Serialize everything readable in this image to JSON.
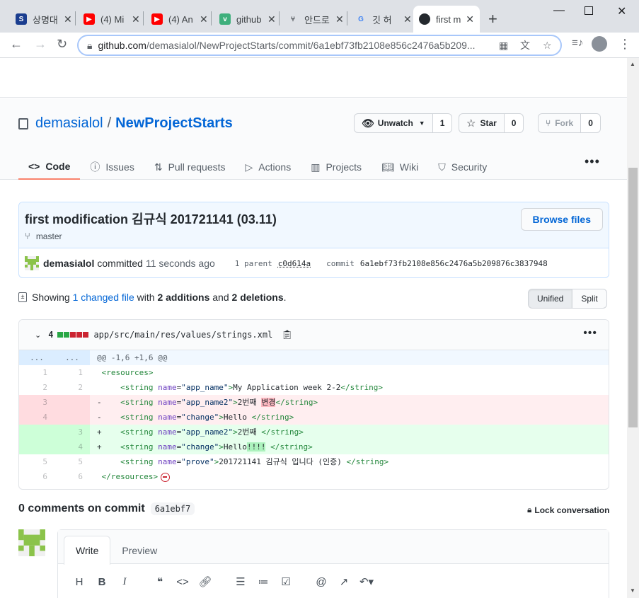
{
  "browser": {
    "tabs": [
      {
        "title": "상명대",
        "fav_color": "#1a3d8f",
        "fav_glyph": "S"
      },
      {
        "title": "(4) Mi",
        "fav_color": "#ff0000",
        "fav_glyph": "▶"
      },
      {
        "title": "(4) An",
        "fav_color": "#ff0000",
        "fav_glyph": "▶"
      },
      {
        "title": "github",
        "fav_color": "#3eaf7c",
        "fav_glyph": "v"
      },
      {
        "title": "안드로",
        "fav_color": "#ffffff",
        "fav_glyph": "⑂"
      },
      {
        "title": "깃 허",
        "fav_color": "#ffffff",
        "fav_glyph": "G"
      },
      {
        "title": "first m",
        "fav_color": "#ffffff",
        "fav_glyph": "●"
      }
    ],
    "url_host": "github.com",
    "url_path": "/demasialol/NewProjectStarts/commit/6a1ebf73fb2108e856c2476a5b209..."
  },
  "repo": {
    "owner": "demasialol",
    "name": "NewProjectStarts",
    "watch_label": "Unwatch",
    "watch_count": "1",
    "star_label": "Star",
    "star_count": "0",
    "fork_label": "Fork",
    "fork_count": "0",
    "nav": [
      {
        "label": "Code",
        "icon": "code-icon"
      },
      {
        "label": "Issues",
        "icon": "issue-icon"
      },
      {
        "label": "Pull requests",
        "icon": "pull-request-icon"
      },
      {
        "label": "Actions",
        "icon": "play-icon"
      },
      {
        "label": "Projects",
        "icon": "project-icon"
      },
      {
        "label": "Wiki",
        "icon": "book-icon"
      },
      {
        "label": "Security",
        "icon": "shield-icon"
      }
    ]
  },
  "commit": {
    "title": "first modification 김규식 201721141 (03.11)",
    "branch": "master",
    "browse_label": "Browse files",
    "author": "demasialol",
    "committed_text": "committed",
    "time": "11 seconds ago",
    "parent_label": "1 parent",
    "parent_sha": "c0d614a",
    "commit_label": "commit",
    "sha": "6a1ebf73fb2108e856c2476a5b209876c3837948"
  },
  "summary": {
    "showing": "Showing",
    "changed": "1 changed file",
    "with": "with",
    "additions": "2 additions",
    "and": "and",
    "deletions": "2 deletions",
    "end": ".",
    "unified": "Unified",
    "split": "Split"
  },
  "file": {
    "count": "4",
    "path": "app/src/main/res/values/strings.xml",
    "hunk": "@@ -1,6 +1,6 @@",
    "hunk_dots": "..."
  },
  "diff_lines": [
    {
      "type": "ctx",
      "old": "1",
      "new": "1",
      "marker": " "
    },
    {
      "type": "ctx",
      "old": "2",
      "new": "2",
      "marker": " "
    },
    {
      "type": "del",
      "old": "3",
      "new": "",
      "marker": "-"
    },
    {
      "type": "del",
      "old": "4",
      "new": "",
      "marker": "-"
    },
    {
      "type": "add",
      "old": "",
      "new": "3",
      "marker": "+"
    },
    {
      "type": "add",
      "old": "",
      "new": "4",
      "marker": "+"
    },
    {
      "type": "ctx",
      "old": "5",
      "new": "5",
      "marker": " "
    },
    {
      "type": "ctx",
      "old": "6",
      "new": "6",
      "marker": " "
    }
  ],
  "comments": {
    "title": "0 comments on commit",
    "sha_short": "6a1ebf7",
    "lock_label": "Lock conversation",
    "write_tab": "Write",
    "preview_tab": "Preview"
  },
  "colors": {
    "link": "#0366d6",
    "active_tab_underline": "#f9826c",
    "addition": "#28a745",
    "deletion": "#cb2431"
  }
}
